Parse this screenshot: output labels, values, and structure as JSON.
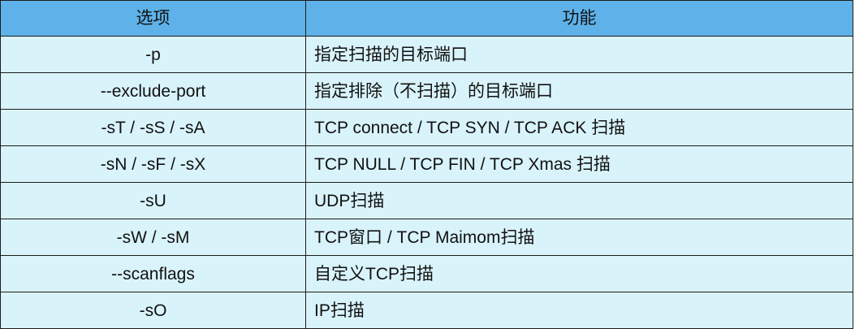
{
  "table": {
    "headers": [
      "选项",
      "功能"
    ],
    "rows": [
      {
        "option": "-p",
        "function": "指定扫描的目标端口"
      },
      {
        "option": "--exclude-port",
        "function": "指定排除（不扫描）的目标端口"
      },
      {
        "option": "-sT / -sS / -sA",
        "function": "TCP connect / TCP SYN / TCP ACK 扫描"
      },
      {
        "option": "-sN / -sF / -sX",
        "function": "TCP NULL / TCP FIN / TCP Xmas 扫描"
      },
      {
        "option": "-sU",
        "function": "UDP扫描"
      },
      {
        "option": "-sW / -sM",
        "function": "TCP窗口 / TCP Maimom扫描"
      },
      {
        "option": "--scanflags",
        "function": "自定义TCP扫描"
      },
      {
        "option": "-sO",
        "function": "IP扫描"
      }
    ]
  },
  "colors": {
    "header_bg": "#5eb2e9",
    "row_bg": "#d9f3fb",
    "border": "#1c1c1c",
    "text": "#111111"
  }
}
